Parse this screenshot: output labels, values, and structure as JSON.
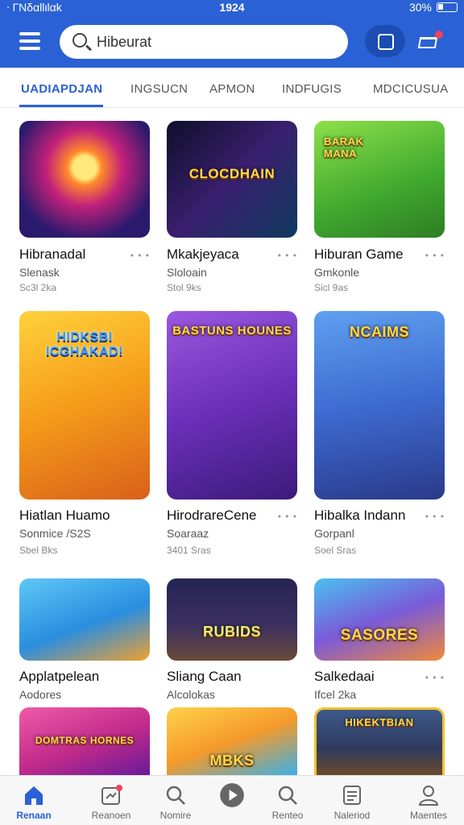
{
  "status": {
    "carrier": "ᐧ ΓΝδαllιlαk",
    "time": "1924",
    "battery": "30%"
  },
  "search": {
    "value": "Hibeurat"
  },
  "tabs": [
    "UADIAPDJAN",
    "INGSUCN",
    "APMON",
    "INDFUGIS",
    "MDCICUSUA"
  ],
  "cards": [
    {
      "caption": "",
      "title": "Hibranadal",
      "sub": "Slenask",
      "meta": "Sc3l 2ka",
      "bg": "#2a1a6e"
    },
    {
      "caption": "CLOCDHAIN",
      "title": "Mkakjeyaca",
      "sub": "Sloloain",
      "meta": "Stol 9ks",
      "bg": "#1a1f3a"
    },
    {
      "caption": "BARAK MANA",
      "title": "Hiburan Game",
      "sub": "Gmkonle",
      "meta": "Sicl 9as",
      "bg": "#56c23a"
    },
    {
      "caption": "HIDKSBI ICGHAKAD!",
      "title": "Hiatlan Huamo",
      "sub": "Sonmice /S2S",
      "meta": "Sbel Bks",
      "bg": "#f5a31a"
    },
    {
      "caption": "BASTUNS HOUNES",
      "title": "HirodrareCene",
      "sub": "Soaraaz",
      "meta": "3401 Sras",
      "bg": "#7a3fc2"
    },
    {
      "caption": "NCAIMS",
      "title": "Hibalka Indann",
      "sub": "Gorpanl",
      "meta": "Soel Sras",
      "bg": "#3d7ad6"
    },
    {
      "caption": "",
      "title": "Applatpelean",
      "sub": "Aodores",
      "meta": "",
      "bg": "#39a6e6"
    },
    {
      "caption": "RUBIDS",
      "title": "Sliang Caan",
      "sub": "Alcolokas",
      "meta": "",
      "bg": "#2d2a54"
    },
    {
      "caption": "SASORES",
      "title": "Salkedaai",
      "sub": "Ifcel 2ka",
      "meta": "",
      "bg": "#3aa8e0"
    },
    {
      "caption": "DOMTRAS HORNES",
      "title": "",
      "sub": "",
      "meta": "",
      "bg": "#d8408f"
    },
    {
      "caption": "MBKS",
      "title": "",
      "sub": "",
      "meta": "",
      "bg": "#f3b02a"
    },
    {
      "caption": "HIKEKTBIAN",
      "title": "",
      "sub": "",
      "meta": "",
      "bg": "#3e4f7a"
    }
  ],
  "nav": [
    {
      "label": "Renaan",
      "icon": "home-icon"
    },
    {
      "label": "Reanoen",
      "icon": "notification-icon"
    },
    {
      "label": "Nomire",
      "icon": "search-icon"
    },
    {
      "label": "",
      "icon": "play-icon"
    },
    {
      "label": "Renteo",
      "icon": "search-icon"
    },
    {
      "label": "Naleriod",
      "icon": "document-icon"
    },
    {
      "label": "Maentes",
      "icon": "profile-icon"
    }
  ],
  "colors": {
    "accent": "#2a61d4",
    "badge": "#f2425b"
  }
}
